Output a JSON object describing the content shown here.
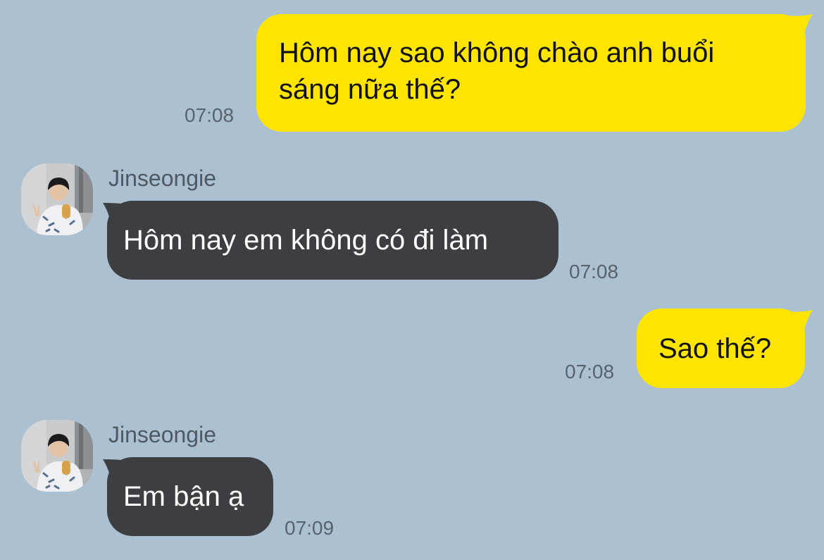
{
  "colors": {
    "background": "#abc1d1",
    "outgoing_bubble": "#fee500",
    "incoming_bubble": "#3d3e41",
    "timestamp": "#58636e",
    "sender_name": "#4e5964"
  },
  "messages": [
    {
      "direction": "outgoing",
      "text_line1": "Hôm nay sao không chào anh buổi",
      "text_line2": "sáng nữa thế?",
      "time": "07:08"
    },
    {
      "direction": "incoming",
      "sender": "Jinseongie",
      "avatar_icon": "profile-photo-icon",
      "text": "Hôm nay em không có đi làm",
      "time": "07:08"
    },
    {
      "direction": "outgoing",
      "text": "Sao thế?",
      "time": "07:08"
    },
    {
      "direction": "incoming",
      "sender": "Jinseongie",
      "avatar_icon": "profile-photo-icon",
      "text": "Em bận ạ",
      "time": "07:09"
    }
  ]
}
